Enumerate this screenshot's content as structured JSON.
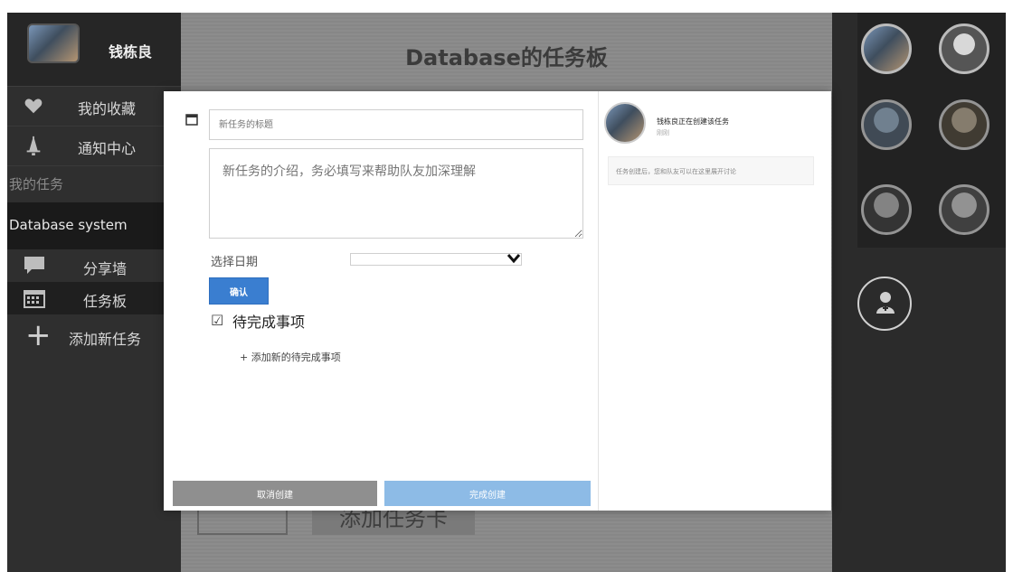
{
  "sidebar": {
    "user_name": "钱栋良",
    "favorites_label": "我的收藏",
    "notifications_label": "通知中心",
    "my_tasks_label": "我的任务",
    "active_project": "Database system",
    "share_wall_label": "分享墙",
    "task_board_label": "任务板",
    "add_task_label": "添加新任务"
  },
  "board": {
    "title": "Database的任务板",
    "ghost_button_label": "添加任务卡"
  },
  "modal": {
    "title_placeholder": "新任务的标题",
    "description_placeholder": "新任务的介绍，务必填写来帮助队友加深理解",
    "date_label": "选择日期",
    "date_value": "",
    "confirm_label": "确认",
    "todo_title": "待完成事项",
    "add_todo_label": "+ 添加新的待完成事项",
    "cancel_label": "取消创建",
    "finish_label": "完成创建",
    "activity": {
      "text": "钱栋良正在创建该任务",
      "time": "刚刚",
      "note": "任务创建后，您和队友可以在这里展开讨论"
    }
  },
  "members": {
    "avatars": [
      "member-1",
      "member-2",
      "member-3",
      "member-4",
      "member-5",
      "member-6"
    ],
    "add_icon": "add-member-icon"
  },
  "colors": {
    "accent": "#3a7ed0",
    "finish_button": "#8dbbe6",
    "sidebar_bg": "#2f2f2f",
    "board_bg": "#8c8c8c"
  }
}
